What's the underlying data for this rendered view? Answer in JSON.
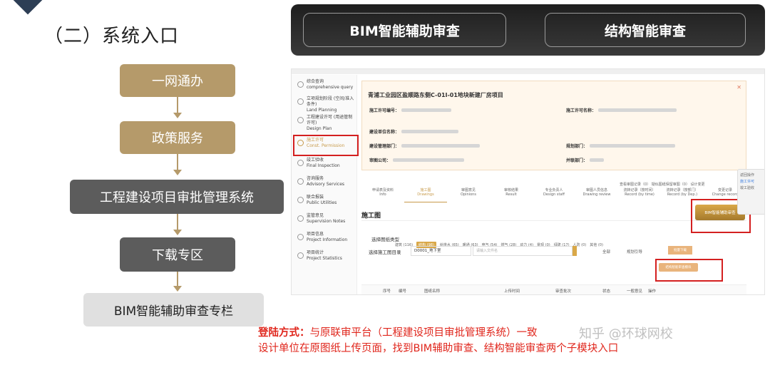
{
  "section_title": "（二）系统入口",
  "flow": [
    "一网通办",
    "政策服务",
    "工程建设项目审批管理系统",
    "下载专区",
    "BIM智能辅助审查专栏"
  ],
  "banner": {
    "left": "BIM智能辅助审查",
    "right": "结构智能审查"
  },
  "sidebar": [
    {
      "cn": "综合查询",
      "en": "comprehensive query",
      "icon": "search-icon"
    },
    {
      "cn": "立项规划阶段 (空间/准入条件)",
      "en": "Land Planning",
      "icon": "tree-icon"
    },
    {
      "cn": "工程建设许可 (用途管制许可)",
      "en": "Design Plan",
      "icon": "switch-icon"
    },
    {
      "cn": "施工许可",
      "en": "Const. Permission",
      "icon": "permit-icon"
    },
    {
      "cn": "竣工验收",
      "en": "Final Inspection",
      "icon": "mail-icon"
    },
    {
      "cn": "咨询服务",
      "en": "Advisory Services",
      "icon": "service-icon"
    },
    {
      "cn": "联合报装",
      "en": "Public Utilities",
      "icon": "link-icon"
    },
    {
      "cn": "监管意见",
      "en": "Supervision Notes",
      "icon": "note-icon"
    },
    {
      "cn": "项目信息",
      "en": "Project Information",
      "icon": "info-icon"
    },
    {
      "cn": "项目统计",
      "en": "Project Statistics",
      "icon": "chart-icon"
    }
  ],
  "project": {
    "title": "青浦工业园区盈顺路东侧C-01I-01地块新建厂房项目",
    "fields": [
      "施工许可编号：",
      "施工许可名称：",
      "建设单位名称：",
      "建设管理部门：",
      "规划部门：",
      "审图公司：",
      "并联部门："
    ]
  },
  "top_links": "查看审图记录（0）  疑似图纸保留审图（0）  设计变更",
  "tabs": [
    {
      "cn": "申请表及资料",
      "en": "Info"
    },
    {
      "cn": "施工图",
      "en": "Drawings"
    },
    {
      "cn": "审图意见",
      "en": "Opinions"
    },
    {
      "cn": "审核结果",
      "en": "Result"
    },
    {
      "cn": "专业负责人",
      "en": "Design staff"
    },
    {
      "cn": "审图人员信息",
      "en": "Drawing review"
    },
    {
      "cn": "流转记录（按时间）",
      "en": "Record (by time)"
    },
    {
      "cn": "流转记录（按部门）",
      "en": "Record (by Dep.)"
    },
    {
      "cn": "变更记录",
      "en": "Change record"
    }
  ],
  "drawings_title": "施工图",
  "bim_button": "BIM智能辅助审查",
  "struct_button": "结构智能审查模块",
  "type_label": "选择图纸类型",
  "chips": [
    "建筑 (116)",
    "结构 (98)",
    "给排水 (65)",
    "暖通 (63)",
    "电气 (54)",
    "燃气 (28)",
    "动力 (4)",
    "景观 (0)",
    "绿建 (17)",
    "人防 (0)",
    "其他 (0)"
  ],
  "dir_label": "选择施工图目录",
  "dir_value": "D0001_地下室",
  "search_placeholder": "请输入文件名",
  "opt_all": "全部",
  "opt_check": "规划引导",
  "download": "批量下载",
  "table_cols": [
    "序号",
    "编号",
    "图纸名称",
    "上传时间",
    "审查批次",
    "状态",
    "一般意见",
    "操作"
  ],
  "right_strip": [
    "返回操作",
    "施工许可",
    "竣工验收"
  ],
  "note_label": "登陆方式：",
  "note_line1": "与原联审平台（工程建设项目审批管理系统）一致",
  "note_line2": "设计单位在原图纸上传页面，找到BIM辅助审查、结构智能审查两个子模块入口",
  "watermark": "知乎 @环球网校"
}
